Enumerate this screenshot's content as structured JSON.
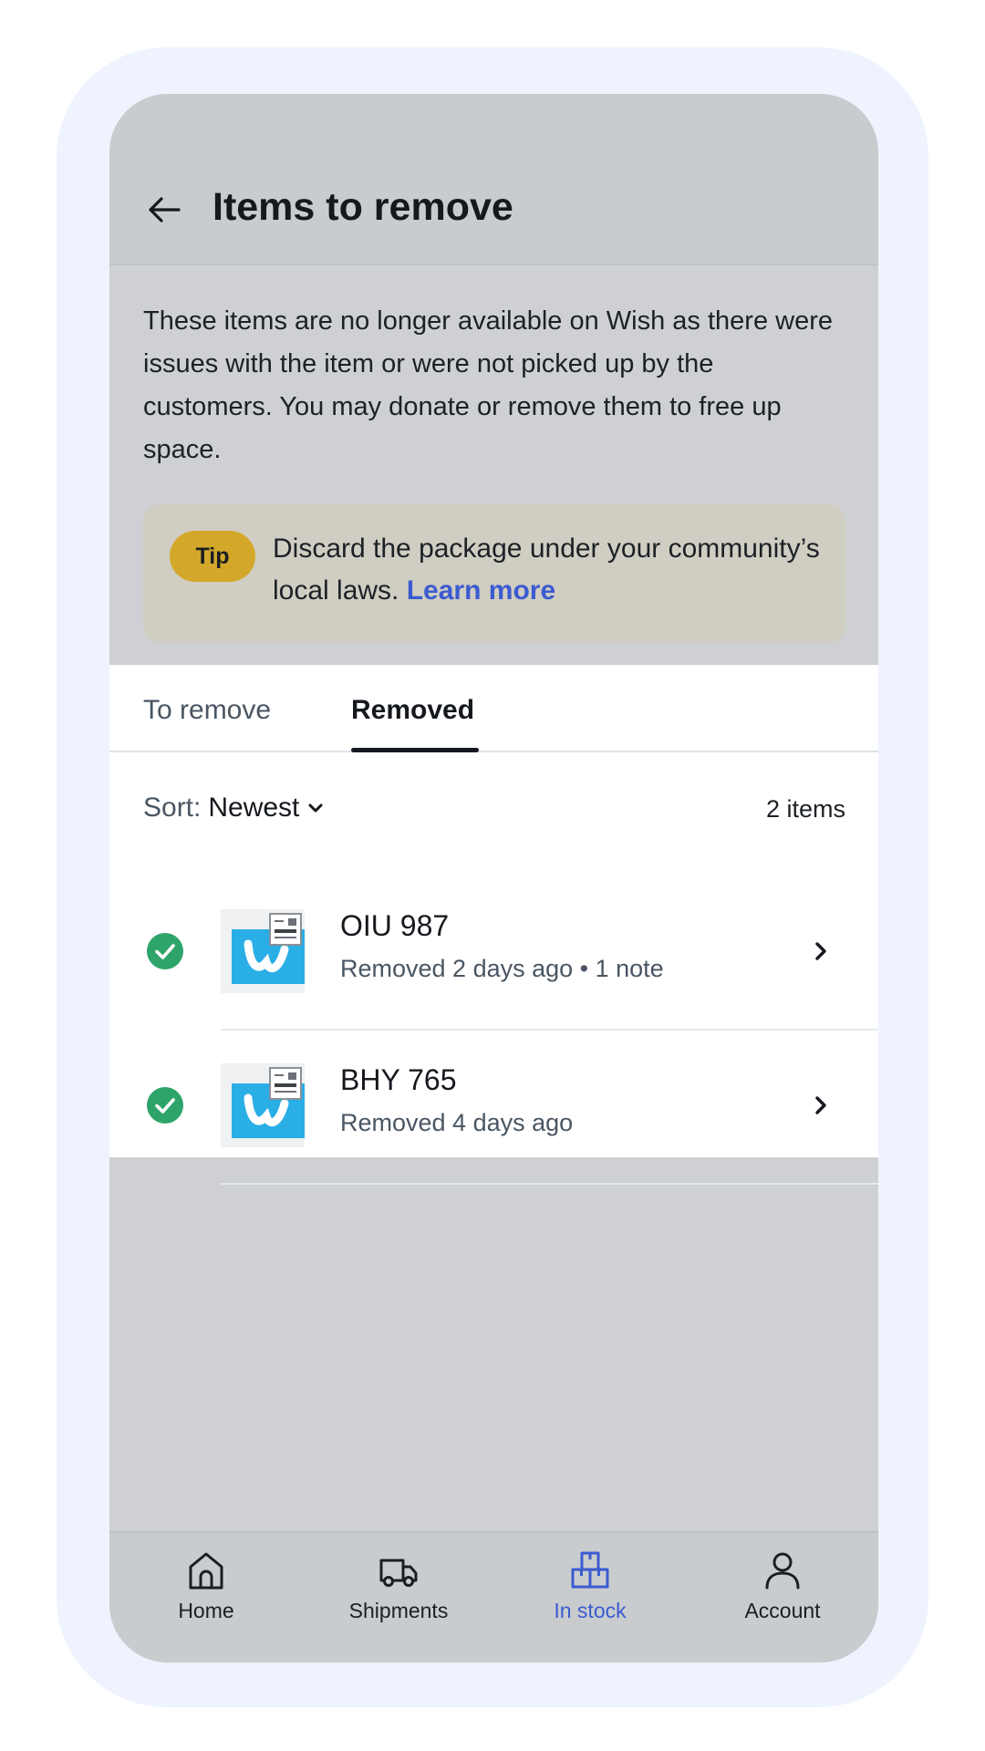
{
  "header": {
    "title": "Items to remove"
  },
  "description": "These items are no longer available on Wish as there were issues with the item or were not picked up by the customers. You may donate or remove them to free up space.",
  "tip": {
    "badge": "Tip",
    "text": "Discard the package under your community’s local laws.",
    "link": "Learn more"
  },
  "tabs": [
    {
      "label": "To remove",
      "active": false
    },
    {
      "label": "Removed",
      "active": true
    }
  ],
  "sort": {
    "label": "Sort:",
    "value": "Newest"
  },
  "count": "2 items",
  "items": [
    {
      "name": "OIU 987",
      "subtitle": "Removed 2 days ago • 1 note",
      "status": "removed"
    },
    {
      "name": "BHY 765",
      "subtitle": "Removed 4 days ago",
      "status": "removed"
    }
  ],
  "nav": [
    {
      "label": "Home",
      "icon": "home-icon"
    },
    {
      "label": "Shipments",
      "icon": "truck-icon"
    },
    {
      "label": "In stock",
      "icon": "boxes-icon",
      "active": true
    },
    {
      "label": "Account",
      "icon": "person-icon"
    }
  ],
  "colors": {
    "accent": "#3b5bd0",
    "success": "#2fa46a",
    "tip_badge": "#d3a82a",
    "thumbnail": "#29aee6"
  }
}
